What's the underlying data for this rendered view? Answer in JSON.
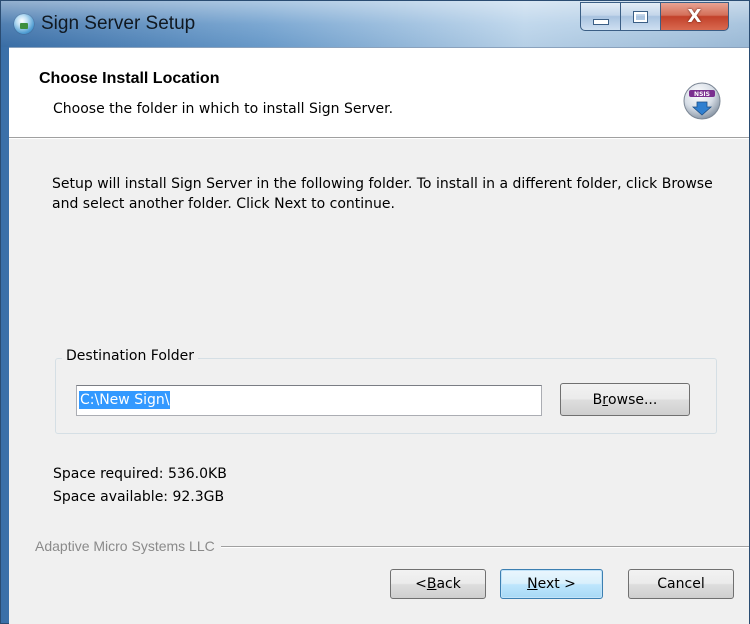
{
  "window": {
    "title": "Sign Server Setup",
    "close_glyph": "X"
  },
  "header": {
    "title": "Choose Install Location",
    "subtitle": "Choose the folder in which to install Sign Server.",
    "logo_text": "NSIS"
  },
  "body": {
    "intro": "Setup will install Sign Server in the following folder. To install in a different folder, click Browse and select another folder. Click Next to continue."
  },
  "destination": {
    "group_label": "Destination Folder",
    "path_value": "C:\\New Sign\\",
    "browse_pre": "B",
    "browse_ul": "r",
    "browse_post": "owse..."
  },
  "space": {
    "required": "Space required: 536.0KB",
    "available": "Space available: 92.3GB"
  },
  "branding": {
    "text": "Adaptive Micro Systems LLC"
  },
  "buttons": {
    "back_pre": "< ",
    "back_ul": "B",
    "back_post": "ack",
    "next_ul": "N",
    "next_post": "ext >",
    "cancel": "Cancel"
  },
  "colors": {
    "selection": "#3399ff",
    "close_button": "#c2412a",
    "dialog_bg": "#f0f0f0"
  }
}
